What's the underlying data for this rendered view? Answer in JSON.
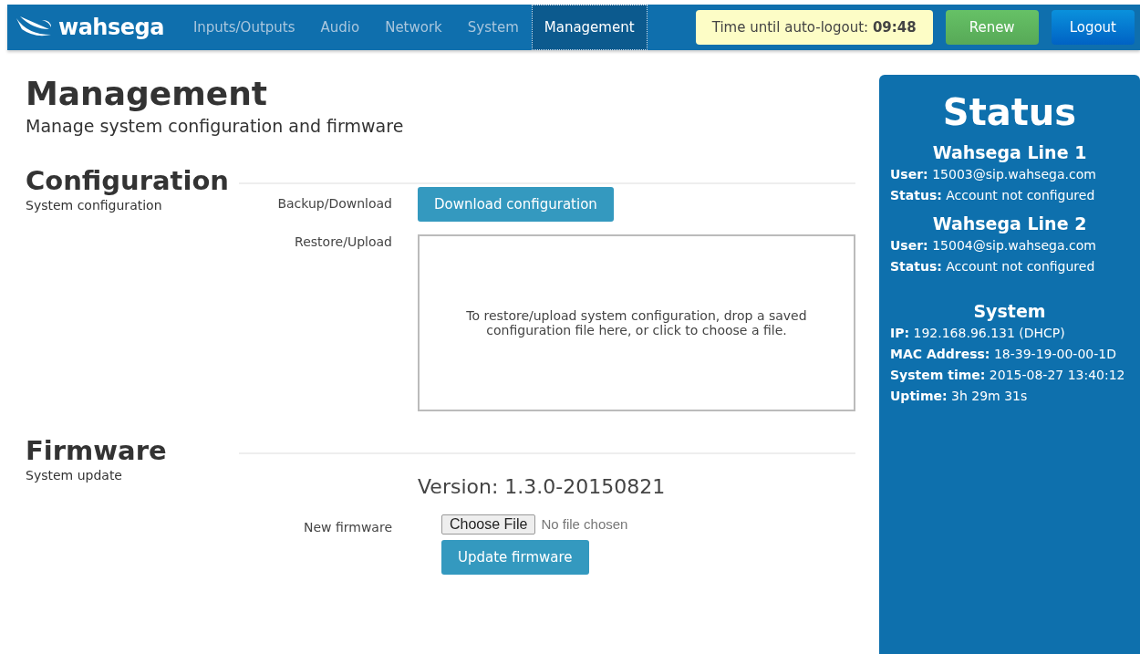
{
  "navbar": {
    "logo": "wahsega",
    "tabs": [
      {
        "label": "Inputs/Outputs",
        "selected": false
      },
      {
        "label": "Audio",
        "selected": false
      },
      {
        "label": "Network",
        "selected": false
      },
      {
        "label": "System",
        "selected": false
      },
      {
        "label": "Management",
        "selected": true
      }
    ],
    "timer": "Time until auto-logout: **09:48**",
    "renew_button": "Renew",
    "logout_button": "Logout"
  },
  "page": {
    "title": "Management",
    "subtitle": "Manage system configuration and firmware"
  },
  "configuration": {
    "heading": "Configuration",
    "description": "System configuration",
    "backup_label": "Backup/Download",
    "download_button": "Download configuration",
    "restore_label": "Restore/Upload",
    "dropzone_text": "To restore/upload system configuration, drop a saved configuration file here, or click to choose a file."
  },
  "firmware": {
    "heading": "Firmware",
    "description": "System update",
    "version": "Version: 1.3.0-20150821",
    "new_firmware_label": "New firmware",
    "choose_file_button": "Choose File",
    "no_file_text": "No file chosen",
    "update_button": "Update firmware"
  },
  "status": {
    "title": "Status",
    "groups": [
      {
        "heading": "Wahsega Line 1",
        "items": [
          {
            "label": "User:",
            "value": "15003@sip.wahsega.com"
          },
          {
            "label": "Status:",
            "value": "Account not configured"
          }
        ]
      },
      {
        "heading": "Wahsega Line 2",
        "items": [
          {
            "label": "User:",
            "value": "15004@sip.wahsega.com"
          },
          {
            "label": "Status:",
            "value": "Account not configured"
          }
        ]
      },
      {
        "heading": "System",
        "items": [
          {
            "label": "IP:",
            "value": "192.168.96.131 (DHCP)"
          },
          {
            "label": "MAC Address:",
            "value": "18-39-19-00-00-1D"
          },
          {
            "label": "System time:",
            "value": "2015-08-27 13:40:12"
          },
          {
            "label": "Uptime:",
            "value": "3h 29m 31s"
          }
        ]
      }
    ]
  }
}
